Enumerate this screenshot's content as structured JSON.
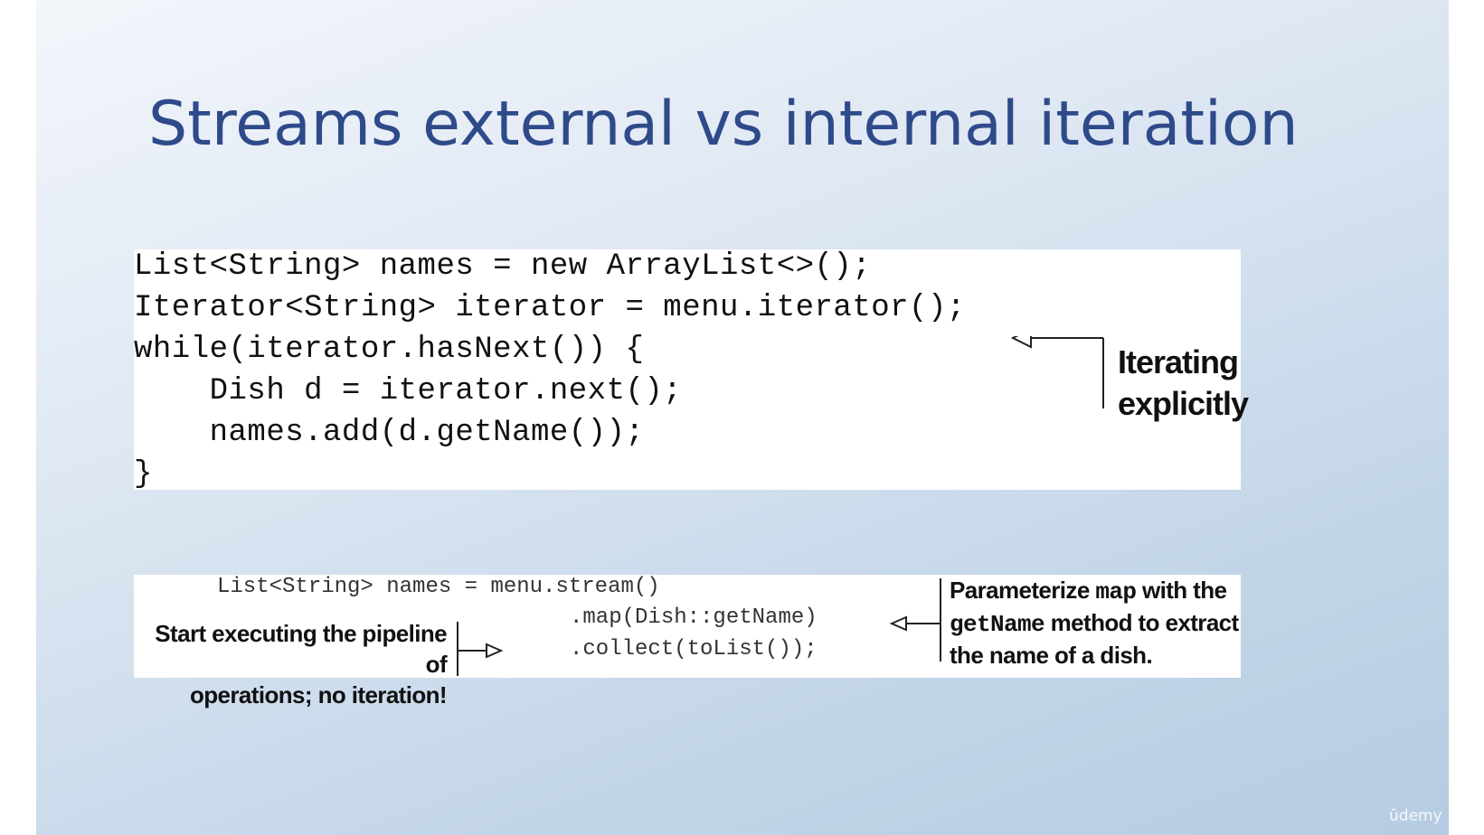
{
  "slide": {
    "title": "Streams external vs internal iteration"
  },
  "external": {
    "lines": [
      "List<String> names = new ArrayList<>();",
      "Iterator<String> iterator = menu.iterator();",
      "while(iterator.hasNext()) {",
      "    Dish d = iterator.next();",
      "    names.add(d.getName());",
      "}"
    ],
    "annotation_line1": "Iterating",
    "annotation_line2": "explicitly"
  },
  "internal": {
    "code_line1": "List<String> names = menu.stream()",
    "code_line2": ".map(Dish::getName)",
    "code_line3": ".collect(toList());",
    "left_label_line1": "Start executing the pipeline of",
    "left_label_line2": "operations; no iteration!",
    "right_label_part1": "Parameterize ",
    "right_label_code1": "map",
    "right_label_part2": " with the",
    "right_label_code2": "getName",
    "right_label_part3": " method to extract",
    "right_label_line3": "the name of a dish."
  },
  "watermark": "ūdemy",
  "colors": {
    "title": "#2e4a8a",
    "background_top": "#f3f6fb",
    "background_bottom": "#b6cce3"
  }
}
